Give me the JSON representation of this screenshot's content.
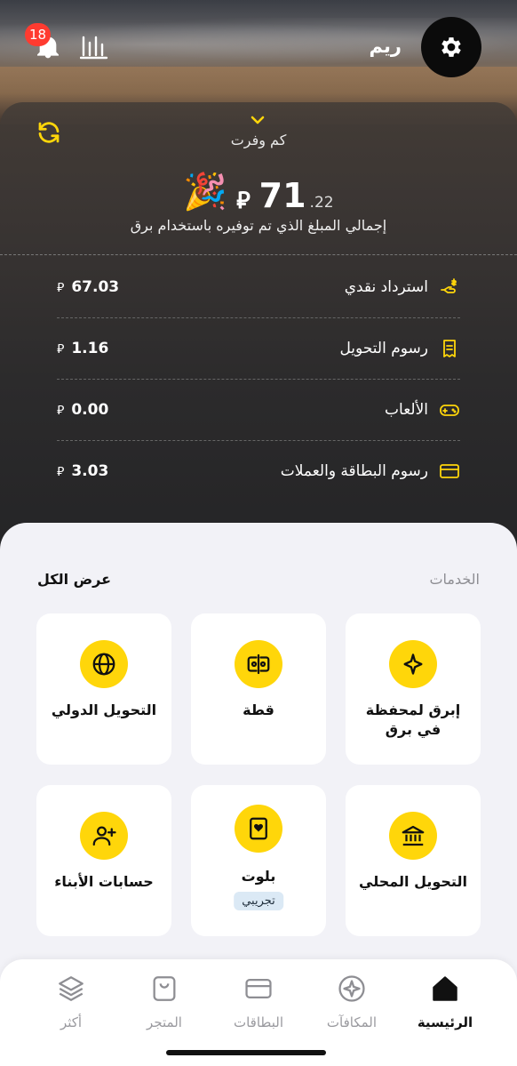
{
  "header": {
    "username": "ريم",
    "notifications_count": "18"
  },
  "savings": {
    "selector_label": "كم وفرت",
    "total_integer": "71",
    "total_decimal": ".22",
    "currency_symbol": "⃁",
    "total_label": "إجمالي المبلغ الذي تم توفيره باستخدام برق",
    "party_emoji": "🎉",
    "rows": [
      {
        "label": "استرداد نقدي",
        "amount": "67.03",
        "icon": "cashback-icon"
      },
      {
        "label": "رسوم التحويل",
        "amount": "1.16",
        "icon": "receipt-icon"
      },
      {
        "label": "الألعاب",
        "amount": "0.00",
        "icon": "gamepad-icon"
      },
      {
        "label": "رسوم البطاقة والعملات",
        "amount": "3.03",
        "icon": "card-icon"
      }
    ]
  },
  "services": {
    "title": "الخدمات",
    "see_all": "عرض الكل",
    "cards": [
      {
        "label": "إبرق لمحفظة في برق",
        "icon": "sparkle-icon"
      },
      {
        "label": "قطة",
        "icon": "split-icon"
      },
      {
        "label": "التحويل الدولي",
        "icon": "globe-icon"
      },
      {
        "label": "التحويل المحلي",
        "icon": "bank-icon"
      },
      {
        "label": "بلوت",
        "tag": "تجريبي",
        "icon": "playing-card-icon"
      },
      {
        "label": "حسابات الأبناء",
        "icon": "add-user-icon"
      }
    ]
  },
  "tabbar": {
    "tabs": [
      {
        "label": "الرئيسية",
        "icon": "home-icon",
        "active": true
      },
      {
        "label": "المكافآت",
        "icon": "compass-icon"
      },
      {
        "label": "البطاقات",
        "icon": "card-icon"
      },
      {
        "label": "المتجر",
        "icon": "bag-icon"
      },
      {
        "label": "أكثر",
        "icon": "layers-icon"
      }
    ]
  },
  "colors": {
    "accent": "#FFD60A",
    "badge": "#FF3B30",
    "background_services": "#F2F2F7"
  }
}
